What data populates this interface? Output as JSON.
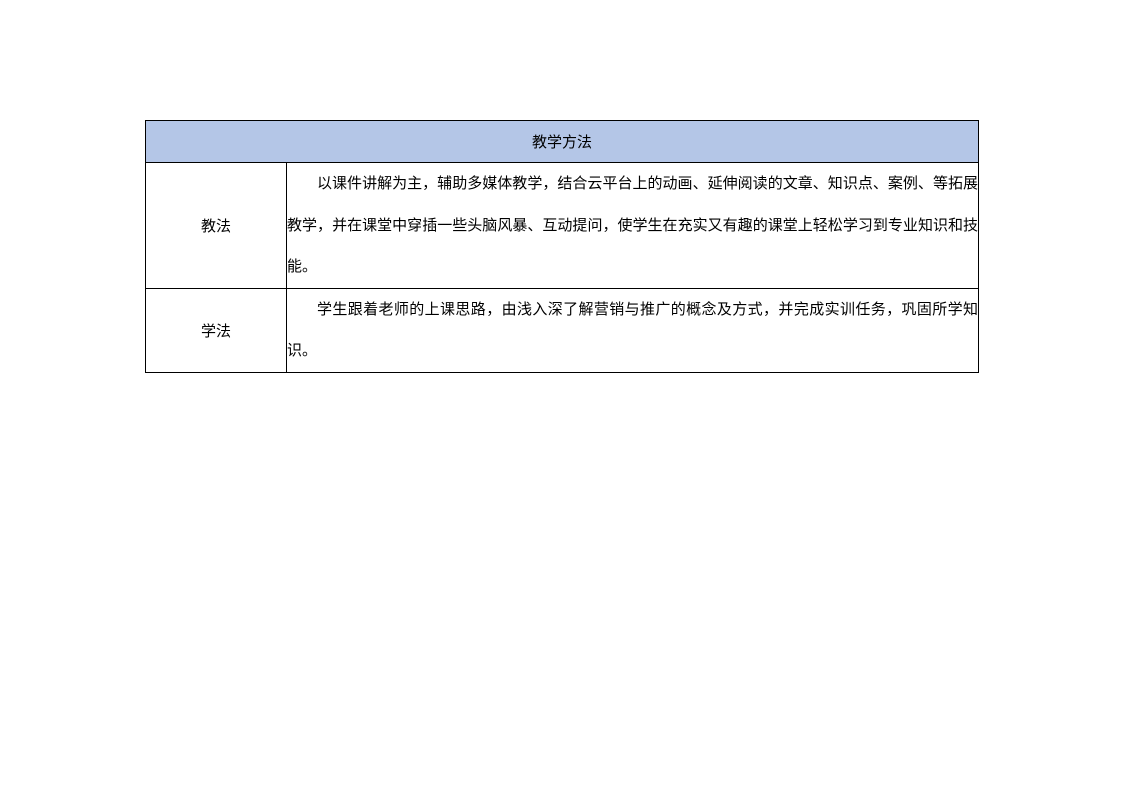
{
  "table": {
    "title": "教学方法",
    "rows": [
      {
        "label": "教法",
        "content": "以课件讲解为主，辅助多媒体教学，结合云平台上的动画、延伸阅读的文章、知识点、案例、等拓展教学，并在课堂中穿插一些头脑风暴、互动提问，使学生在充实又有趣的课堂上轻松学习到专业知识和技能。"
      },
      {
        "label": "学法",
        "content": "学生跟着老师的上课思路，由浅入深了解营销与推广的概念及方式，并完成实训任务，巩固所学知识。"
      }
    ]
  }
}
